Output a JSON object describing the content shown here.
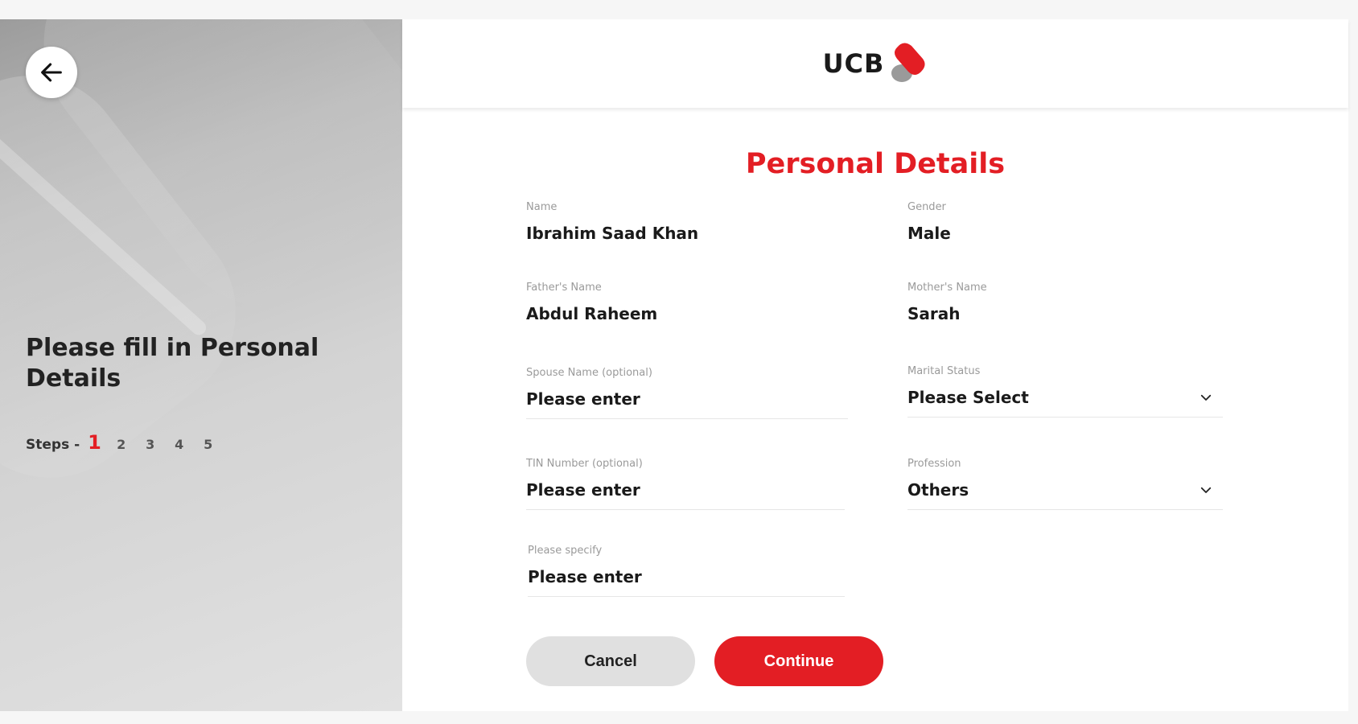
{
  "brand": {
    "logo_text": "UCB",
    "accent_color": "#e31e24"
  },
  "left_panel": {
    "back_icon": "arrow-left-icon",
    "title": "Please fill in Personal Details",
    "steps_label": "Steps -",
    "steps": [
      "1",
      "2",
      "3",
      "4",
      "5"
    ],
    "active_step": "1"
  },
  "form": {
    "title": "Personal Details",
    "fields": {
      "name": {
        "label": "Name",
        "value": "Ibrahim Saad Khan"
      },
      "gender": {
        "label": "Gender",
        "value": "Male"
      },
      "father_name": {
        "label": "Father's Name",
        "value": "Abdul Raheem"
      },
      "mother_name": {
        "label": "Mother's Name",
        "value": "Sarah"
      },
      "spouse_name": {
        "label": "Spouse Name (optional)",
        "value": "Please enter"
      },
      "marital_status": {
        "label": "Marital Status",
        "value": "Please Select",
        "icon": "chevron-down-icon"
      },
      "tin_number": {
        "label": "TIN Number (optional)",
        "value": "Please enter"
      },
      "profession": {
        "label": "Profession",
        "value": "Others",
        "icon": "chevron-down-icon"
      },
      "please_specify": {
        "label": "Please specify",
        "value": "Please enter"
      }
    },
    "cancel_label": "Cancel",
    "continue_label": "Continue"
  }
}
